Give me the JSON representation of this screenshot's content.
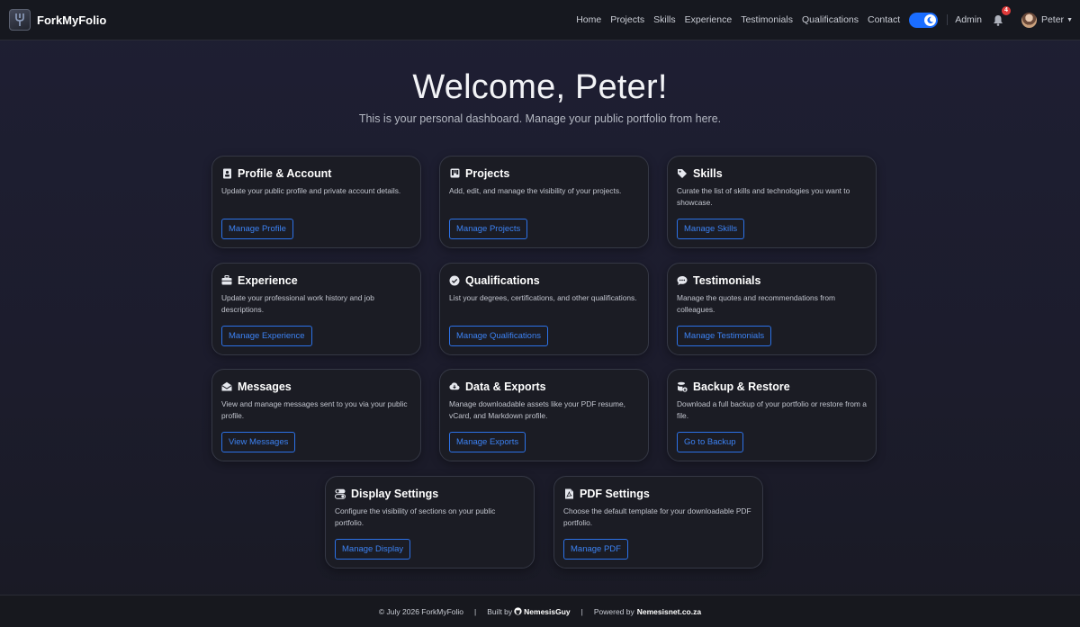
{
  "brand": {
    "name": "ForkMyFolio"
  },
  "nav": {
    "links": [
      "Home",
      "Projects",
      "Skills",
      "Experience",
      "Testimonials",
      "Qualifications",
      "Contact"
    ],
    "admin": "Admin",
    "notifications_count": "4",
    "user_name": "Peter",
    "theme_toggle": "on"
  },
  "hero": {
    "title": "Welcome, Peter!",
    "subtitle": "This is your personal dashboard. Manage your public portfolio from here."
  },
  "cards": [
    {
      "title": "Profile & Account",
      "desc": "Update your public profile and private account details.",
      "button": "Manage Profile",
      "icon": "id-badge-icon"
    },
    {
      "title": "Projects",
      "desc": "Add, edit, and manage the visibility of your projects.",
      "button": "Manage Projects",
      "icon": "kanban-icon"
    },
    {
      "title": "Skills",
      "desc": "Curate the list of skills and technologies you want to showcase.",
      "button": "Manage Skills",
      "icon": "tag-icon"
    },
    {
      "title": "Experience",
      "desc": "Update your professional work history and job descriptions.",
      "button": "Manage Experience",
      "icon": "briefcase-icon"
    },
    {
      "title": "Qualifications",
      "desc": "List your degrees, certifications, and other qualifications.",
      "button": "Manage Qualifications",
      "icon": "patch-check-icon"
    },
    {
      "title": "Testimonials",
      "desc": "Manage the quotes and recommendations from colleagues.",
      "button": "Manage Testimonials",
      "icon": "chat-dots-icon"
    },
    {
      "title": "Messages",
      "desc": "View and manage messages sent to you via your public profile.",
      "button": "View Messages",
      "icon": "envelope-open-icon"
    },
    {
      "title": "Data & Exports",
      "desc": "Manage downloadable assets like your PDF resume, vCard, and Markdown profile.",
      "button": "Manage Exports",
      "icon": "cloud-download-icon"
    },
    {
      "title": "Backup & Restore",
      "desc": "Download a full backup of your portfolio or restore from a file.",
      "button": "Go to Backup",
      "icon": "database-icon"
    },
    {
      "title": "Display Settings",
      "desc": "Configure the visibility of sections on your public portfolio.",
      "button": "Manage Display",
      "icon": "toggles-icon"
    },
    {
      "title": "PDF Settings",
      "desc": "Choose the default template for your downloadable PDF portfolio.",
      "button": "Manage PDF",
      "icon": "file-pdf-icon"
    }
  ],
  "footer": {
    "copyright": "© July 2026 ForkMyFolio",
    "built_by_label": "Built by",
    "built_by_name": "NemesisGuy",
    "powered_by_label": "Powered by",
    "powered_by_name": "Nemesisnet.co.za"
  }
}
